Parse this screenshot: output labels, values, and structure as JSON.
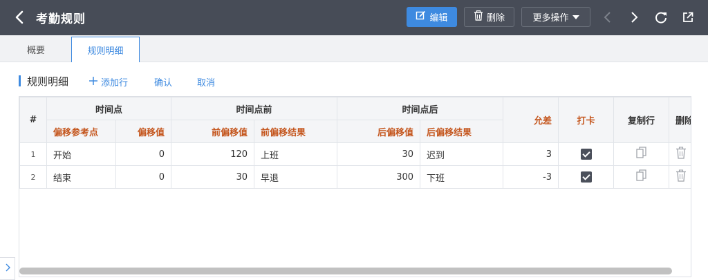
{
  "header": {
    "title": "考勤规则",
    "edit_label": "编辑",
    "delete_label": "删除",
    "more_label": "更多操作"
  },
  "tabs": [
    {
      "label": "概要",
      "active": false
    },
    {
      "label": "规则明细",
      "active": true
    }
  ],
  "section": {
    "title": "规则明细",
    "add_row_label": "添加行",
    "confirm_label": "确认",
    "cancel_label": "取消"
  },
  "table": {
    "index_header": "#",
    "groups": {
      "time_point": "时间点",
      "before": "时间点前",
      "after": "时间点后"
    },
    "columns": {
      "offset_ref": "偏移参考点",
      "offset_value": "偏移值",
      "pre_offset": "前偏移值",
      "pre_result": "前偏移结果",
      "post_offset": "后偏移值",
      "post_result": "后偏移结果",
      "tolerance": "允差",
      "clock_in": "打卡",
      "copy_row": "复制行",
      "delete_row": "删除"
    },
    "rows": [
      {
        "index": "1",
        "offset_ref": "开始",
        "offset_value": "0",
        "pre_offset": "120",
        "pre_result": "上班",
        "post_offset": "30",
        "post_result": "迟到",
        "tolerance": "3",
        "clock_in": true
      },
      {
        "index": "2",
        "offset_ref": "结束",
        "offset_value": "0",
        "pre_offset": "30",
        "pre_result": "早退",
        "post_offset": "300",
        "post_result": "下班",
        "tolerance": "-3",
        "clock_in": true
      }
    ]
  },
  "colors": {
    "topbar": "#474c57",
    "accent": "#3e8ae0",
    "required_header": "#c4551c"
  }
}
